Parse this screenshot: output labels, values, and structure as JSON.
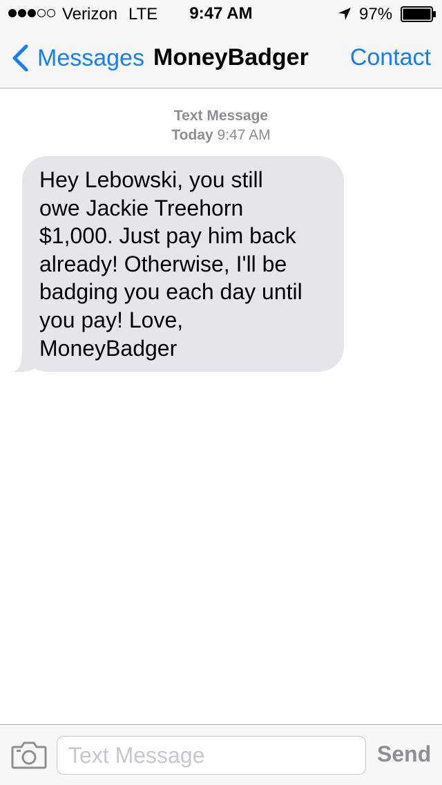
{
  "status_bar": {
    "signal_bars_filled": 3,
    "signal_bars_total": 5,
    "carrier": "Verizon",
    "network": "LTE",
    "time": "9:47 AM",
    "location_icon": "location-arrow-icon",
    "battery_percent": "97%",
    "battery_level": 0.97
  },
  "nav": {
    "back_icon": "chevron-left-icon",
    "back_label": "Messages",
    "title": "MoneyBadger",
    "contact_label": "Contact",
    "accent_color": "#147efb"
  },
  "conversation": {
    "meta_service": "Text Message",
    "meta_day": "Today",
    "meta_time": "9:47 AM",
    "message_lines": [
      "Hey Lebowski, you still",
      "owe Jackie Treehorn",
      "$1,000. Just pay him back",
      "already! Otherwise, I'll be",
      "badging you each day until",
      "you pay! Love,",
      "MoneyBadger"
    ],
    "bubble_color": "#e5e5ea"
  },
  "input_bar": {
    "camera_icon": "camera-icon",
    "placeholder": "Text Message",
    "value": "",
    "send_label": "Send"
  }
}
